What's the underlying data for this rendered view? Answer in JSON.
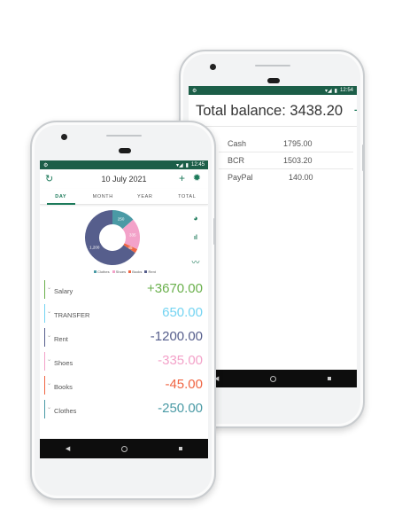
{
  "colors": {
    "status_bar": "#1c5e48",
    "accent": "#1c7a5a",
    "clothes": "#4a9aa5",
    "shoes": "#f3a2c9",
    "books": "#f06543",
    "rent": "#565e8c",
    "salary": "#6ab04c",
    "transfer": "#74d4f2"
  },
  "back_phone": {
    "status_time": "12:54",
    "total_title": "Total balance: 3438.20",
    "add_icon": "plus-icon",
    "accounts": [
      {
        "name": "Cash",
        "value": "1795.00"
      },
      {
        "name": "BCR",
        "value": "1503.20"
      },
      {
        "name": "PayPal",
        "value": "140.00"
      }
    ]
  },
  "front_phone": {
    "status_time": "12:45",
    "date": "10 July 2021",
    "tabs": [
      {
        "label": "DAY",
        "active": true
      },
      {
        "label": "MONTH",
        "active": false
      },
      {
        "label": "YEAR",
        "active": false
      },
      {
        "label": "TOTAL",
        "active": false
      }
    ],
    "chart_data": {
      "type": "pie",
      "categories": [
        "Clothes",
        "Shoes",
        "Books",
        "Rent"
      ],
      "values": [
        250,
        335,
        45,
        1200
      ],
      "labels": [
        "250",
        "335",
        "45",
        "1,200"
      ],
      "legend": [
        "Clothes",
        "Shoes",
        "Books",
        "Rent"
      ]
    },
    "side_icons": [
      "pie-chart-icon",
      "bar-chart-icon",
      "trend-line-icon"
    ],
    "transactions": [
      {
        "name": "Salary",
        "amount": "+3670.00",
        "color": "#6ab04c"
      },
      {
        "name": "TRANSFER",
        "amount": "650.00",
        "color": "#74d4f2"
      },
      {
        "name": "Rent",
        "amount": "-1200.00",
        "color": "#565e8c"
      },
      {
        "name": "Shoes",
        "amount": "-335.00",
        "color": "#f3a2c9"
      },
      {
        "name": "Books",
        "amount": "-45.00",
        "color": "#f06543"
      },
      {
        "name": "Clothes",
        "amount": "-250.00",
        "color": "#4a9aa5"
      }
    ]
  }
}
